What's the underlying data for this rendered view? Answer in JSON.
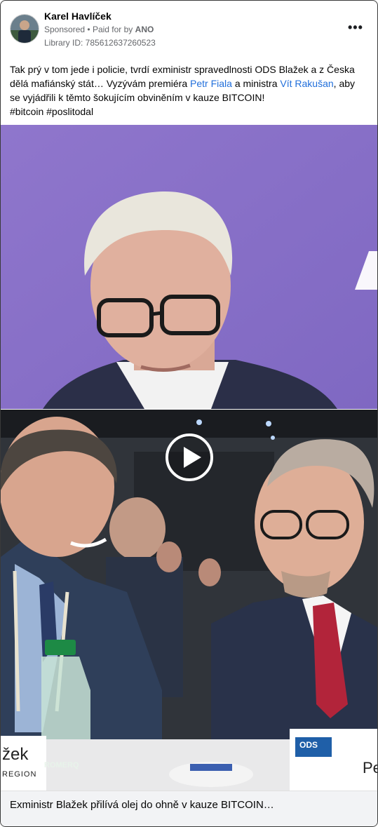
{
  "post": {
    "author": "Karel Havlíček",
    "sponsored": "Sponsored",
    "paid_prefix": "Paid for by",
    "paid_by": "ANO",
    "library_id": "Library ID: 785612637260523",
    "more": "•••",
    "text_1": "Tak prý v tom jede i policie, tvrdí exministr spravedlnosti ODS Blažek a z Česka dělá mafiánský stát… Vyzývám premiéra ",
    "link_1": "Petr Fiala",
    "text_2": " a ministra ",
    "link_2": "Vít Rakušan",
    "text_3": ", aby se vyjádřili k těmto šokujícím obviněním v kauze BITCOIN!",
    "hashtags": "#bitcoin #poslitodal"
  },
  "media": {
    "sign_left": "žek",
    "sign_left_sub": "REGION",
    "bottle_label": "ROMERQ",
    "party_logo": "ODS",
    "sign_right": "Pe"
  },
  "caption": "Exministr Blažek přilívá olej do ohně v kauze BITCOIN…",
  "colors": {
    "link": "#216fdb",
    "purple_bg": "#8a72c9"
  }
}
